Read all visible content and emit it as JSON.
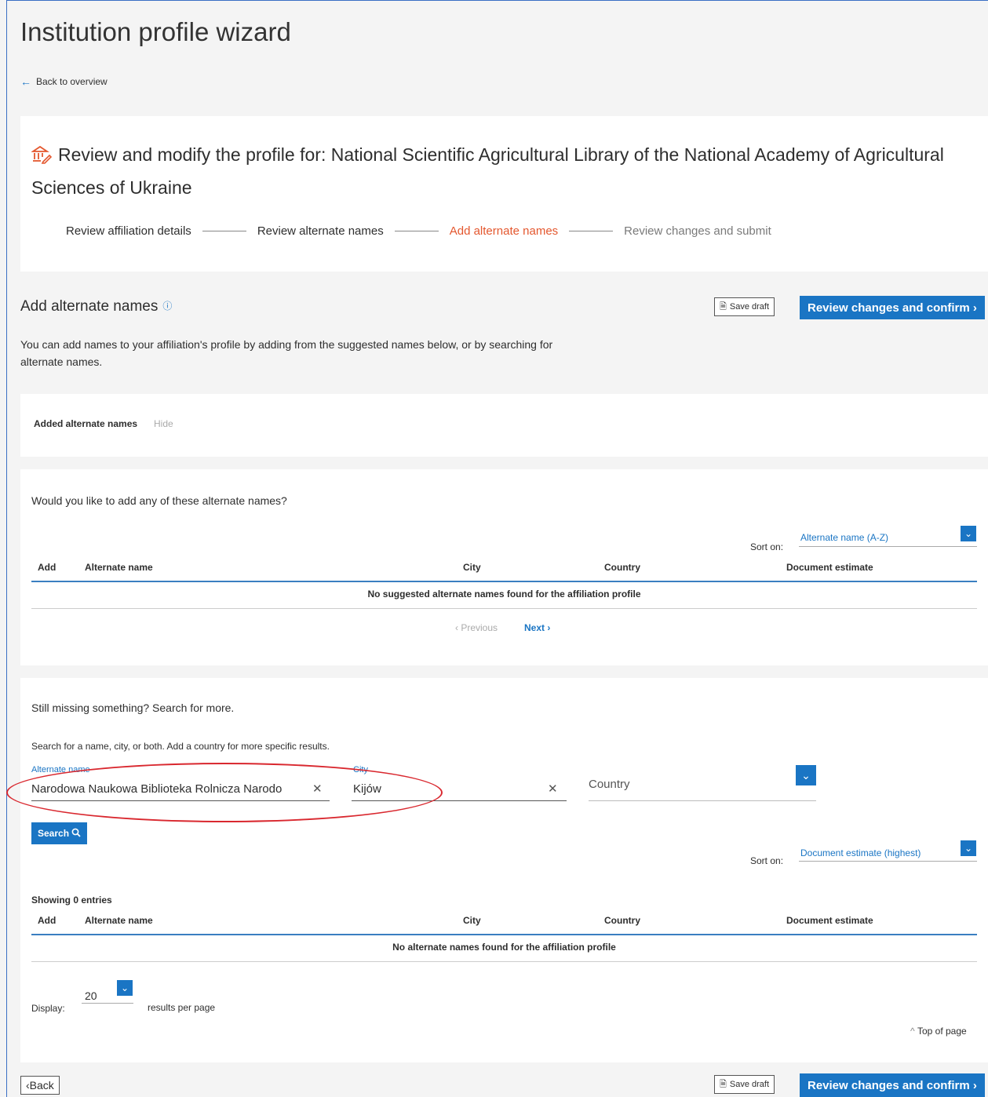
{
  "page": {
    "title": "Institution profile wizard",
    "back_link": "Back to overview"
  },
  "profile": {
    "heading": "Review and modify the profile for:  National Scientific Agricultural Library of the National Academy of Agricultural Sciences of Ukraine",
    "steps": [
      {
        "label": "Review affiliation details",
        "state": "done"
      },
      {
        "label": "Review alternate names",
        "state": "done"
      },
      {
        "label": "Add alternate names",
        "state": "active"
      },
      {
        "label": "Review changes and submit",
        "state": "todo"
      }
    ]
  },
  "section": {
    "title": "Add alternate names",
    "info_icon": "ⓘ",
    "description": "You can add names to your affiliation's profile by adding from the suggested names below, or by searching for alternate names.",
    "save_draft": "Save draft",
    "review_confirm": "Review changes and confirm"
  },
  "added": {
    "label": "Added alternate names",
    "hide": "Hide"
  },
  "suggested": {
    "question": "Would you like to add any of these alternate names?",
    "sort_label": "Sort on:",
    "sort_value": "Alternate name (A-Z)",
    "columns": [
      "Add",
      "Alternate name",
      "City",
      "Country",
      "Document estimate"
    ],
    "empty": "No suggested alternate names found for the affiliation profile",
    "prev": "Previous",
    "next": "Next"
  },
  "search": {
    "heading": "Still missing something? Search for more.",
    "hint": "Search for a name, city, or both. Add a country for more specific results.",
    "name_label": "Alternate name",
    "name_value": "Narodowa Naukowa Biblioteka Rolnicza Narodo",
    "city_label": "City",
    "city_value": "Kijów",
    "country_placeholder": "Country",
    "search_button": "Search",
    "sort_label": "Sort on:",
    "sort_value": "Document estimate (highest)",
    "showing": "Showing 0 entries",
    "columns": [
      "Add",
      "Alternate name",
      "City",
      "Country",
      "Document estimate"
    ],
    "empty": "No alternate names found for the affiliation profile",
    "display_label": "Display:",
    "per_page": "20",
    "per_page_suffix": "results per page",
    "top_of_page": "Top of page"
  },
  "footer": {
    "back": "Back",
    "save_draft": "Save draft",
    "review_confirm": "Review changes and confirm"
  },
  "colors": {
    "accent": "#1a75c4",
    "active_step": "#e4572e",
    "highlight_oval": "#d9282f"
  }
}
